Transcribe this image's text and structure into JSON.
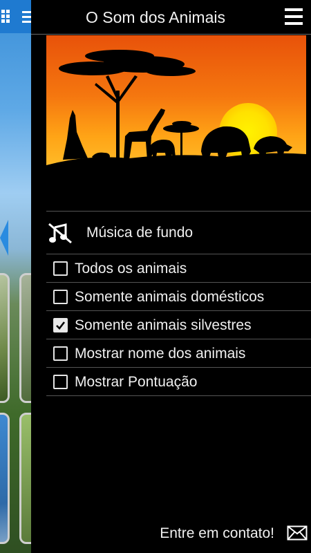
{
  "drawer": {
    "title": "O Som dos Animais",
    "music": {
      "label": "Música de fundo",
      "enabled": false
    },
    "options": [
      {
        "label": "Todos os animais",
        "checked": false
      },
      {
        "label": "Somente animais domésticos",
        "checked": false
      },
      {
        "label": "Somente animais silvestres",
        "checked": true
      },
      {
        "label": "Mostrar nome dos animais",
        "checked": false
      },
      {
        "label": "Mostrar Pontuação",
        "checked": false
      }
    ],
    "contact_label": "Entre em contato!"
  },
  "icons": {
    "menu": "hamburger-menu-icon",
    "music": "music-off-icon",
    "checkbox_checked": "checkmark-icon",
    "mail": "envelope-icon",
    "bg_grid": "grid-icon",
    "bg_menu": "menu-icon",
    "bg_back": "left-arrow-icon"
  },
  "colors": {
    "drawer_bg": "#000000",
    "text": "#f0f0f0",
    "divider": "#555555",
    "bg_app_bar": "#1f7ad0",
    "sunset_orange": "#f07a10",
    "sun_yellow": "#ffe600"
  }
}
